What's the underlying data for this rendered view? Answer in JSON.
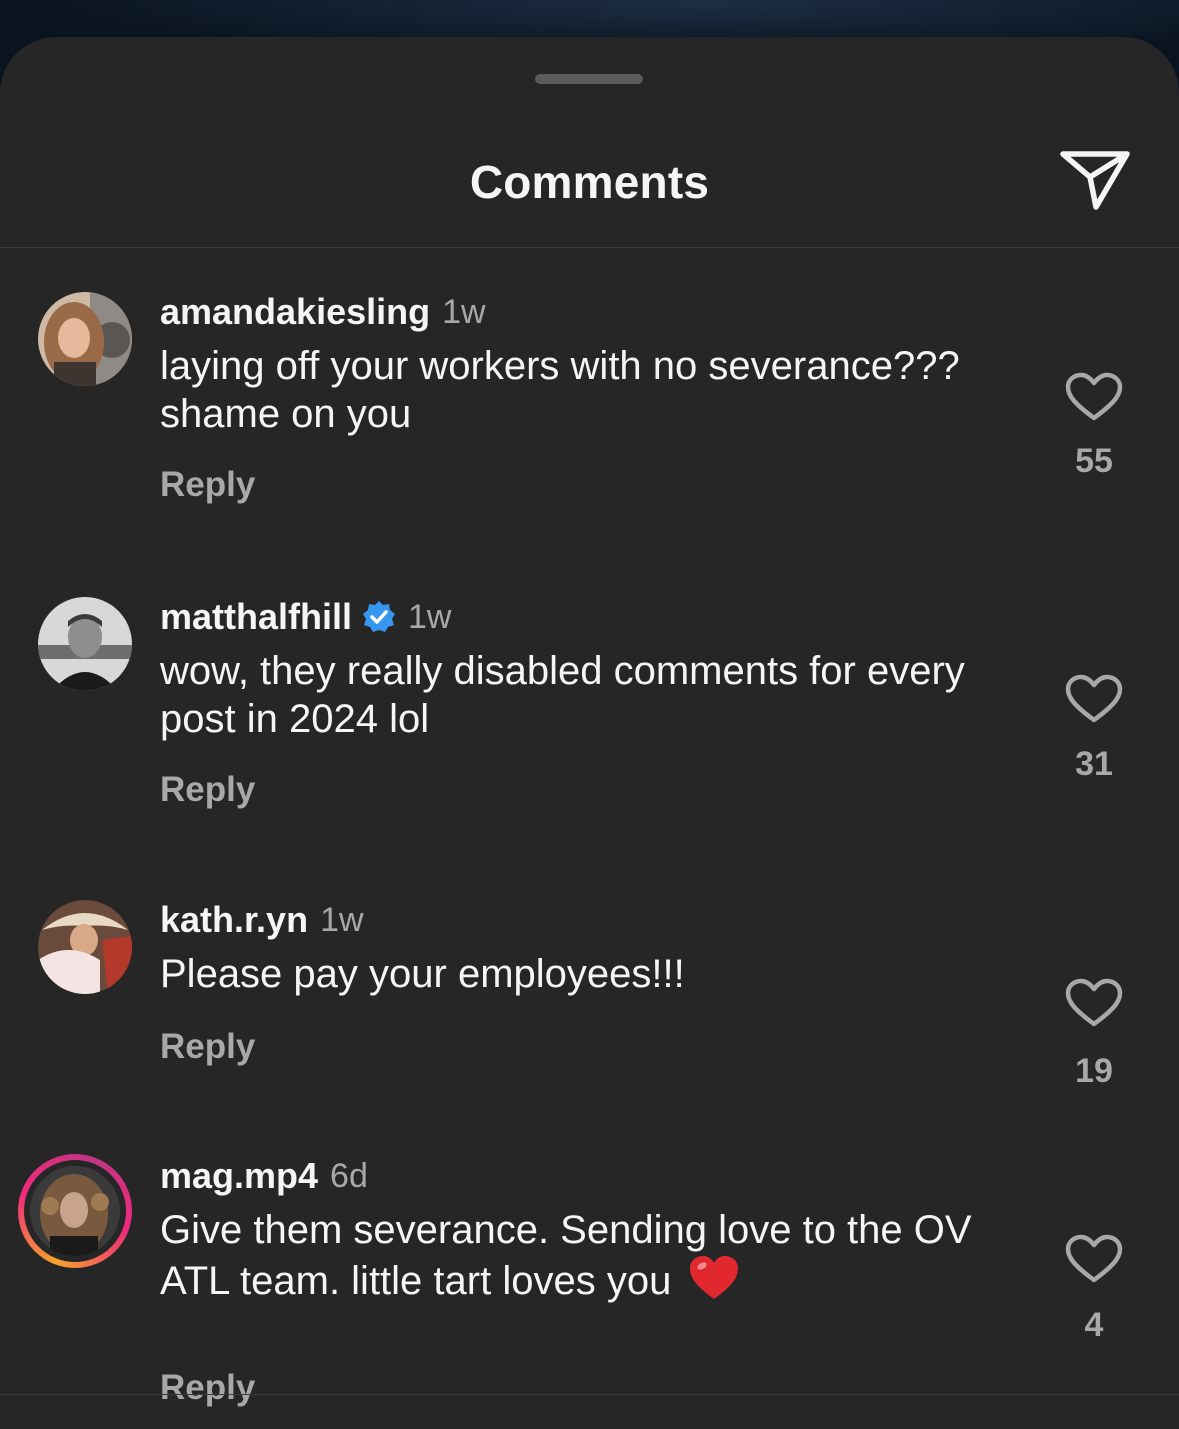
{
  "header": {
    "title": "Comments"
  },
  "icons": {
    "share": "paper-plane-icon",
    "like": "heart-outline-icon",
    "verified": "verified-badge-icon"
  },
  "colors": {
    "sheet": "#262626",
    "text": "#f5f5f5",
    "muted": "#a8a8a8",
    "verified": "#3797f0",
    "emoji_heart": "#e0282e"
  },
  "comments": [
    {
      "username": "amandakiesling",
      "verified": false,
      "time": "1w",
      "text": "laying off your workers with no severance??? shame on you",
      "reply_label": "Reply",
      "likes": "55"
    },
    {
      "username": "matthalfhill",
      "verified": true,
      "time": "1w",
      "text": "wow, they really disabled comments for every post in 2024 lol",
      "reply_label": "Reply",
      "likes": "31"
    },
    {
      "username": "kath.r.yn",
      "verified": false,
      "time": "1w",
      "text": "Please pay your employees!!!",
      "reply_label": "Reply",
      "likes": "19"
    },
    {
      "username": "mag.mp4",
      "verified": false,
      "has_story": true,
      "time": "6d",
      "text": "Give them severance. Sending love to the OV ATL team. little tart loves you",
      "emoji": "red-heart-emoji",
      "reply_label": "Reply",
      "likes": "4"
    }
  ]
}
